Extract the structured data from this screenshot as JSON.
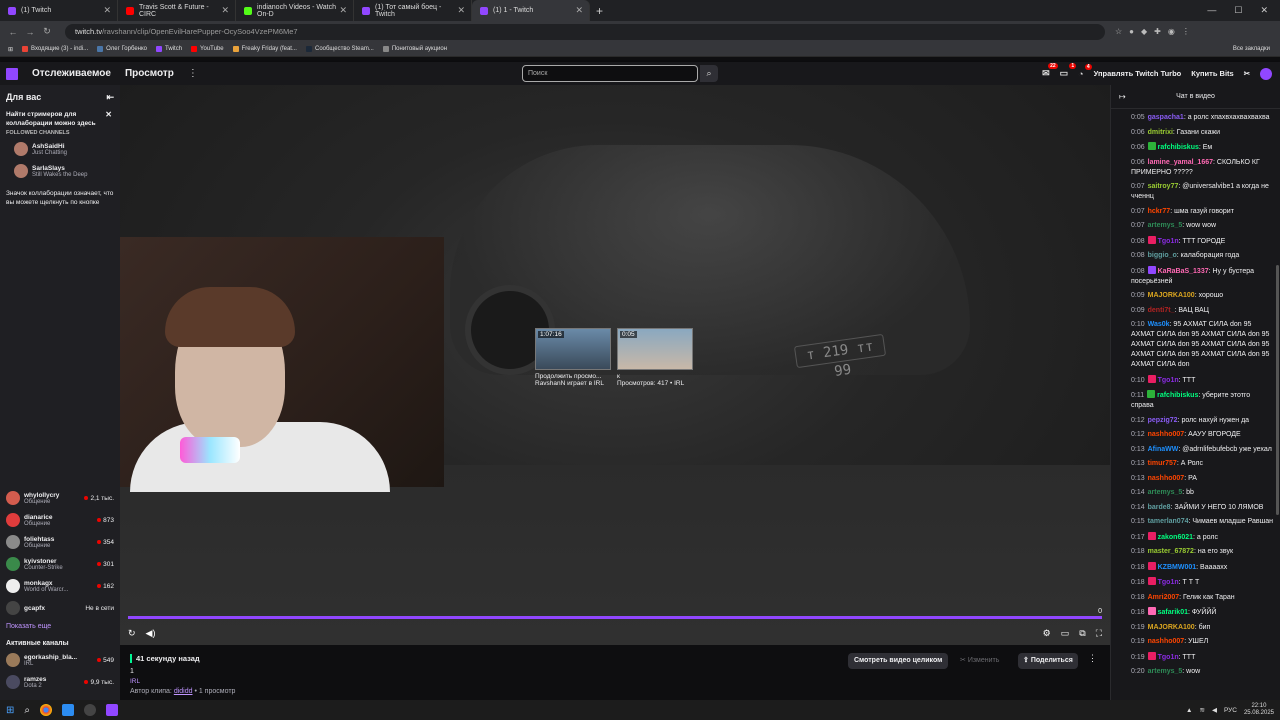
{
  "browser": {
    "tabs": [
      {
        "title": "(1) Twitch",
        "color": "#9147ff",
        "active": false
      },
      {
        "title": "Travis Scott & Future - CIRC",
        "color": "#ff0000",
        "active": false
      },
      {
        "title": "indianoch Videos - Watch On-D",
        "color": "#53fc18",
        "active": false
      },
      {
        "title": "(1) Тот самый боец - Twitch",
        "color": "#9147ff",
        "active": false
      },
      {
        "title": "(1) 1 - Twitch",
        "color": "#9147ff",
        "active": true
      }
    ],
    "url_host": "twitch.tv",
    "url_path": "/ravshann/clip/OpenEvilHarePupper-OcySoo4VzePM6Me7",
    "bookmarks": [
      {
        "label": "Входящие (3) - indi...",
        "color": "#ea4335"
      },
      {
        "label": "Олег Горбенко",
        "color": "#4a76a8"
      },
      {
        "label": "Twitch",
        "color": "#9147ff"
      },
      {
        "label": "YouTube",
        "color": "#ff0000"
      },
      {
        "label": "Freaky Friday (feat...",
        "color": "#e9a23b"
      },
      {
        "label": "Сообщество Steam...",
        "color": "#1b2838"
      },
      {
        "label": "Понитовый аукцион",
        "color": "#888888"
      }
    ],
    "all_bookmarks": "Все закладки"
  },
  "twitch_nav": {
    "following": "Отслеживаемое",
    "browse": "Просмотр",
    "search_placeholder": "Поиск",
    "notif1": "22",
    "notif2": "1",
    "notif3": "4",
    "turbo": "Управлять Twitch Turbo",
    "bits": "Купить Bits"
  },
  "sidebar": {
    "title": "Для вас",
    "popup_title": "Найти стримеров для коллаборации можно здесь",
    "followed_label": "FOLLOWED CHANNELS",
    "popup_channels": [
      {
        "name": "AshSaidHi",
        "sub": "Just Chatting"
      },
      {
        "name": "SarlaSlays",
        "sub": "Still Wakes the Deep"
      }
    ],
    "popup_text": "Значок коллаборации означает, что вы можете щелкнуть по кнопке",
    "channels": [
      {
        "name": "whylollycry",
        "game": "Общение",
        "viewers": "2,1 тыс."
      },
      {
        "name": "dianarice",
        "game": "Общение",
        "viewers": "873"
      },
      {
        "name": "foliehtass",
        "game": "Общение",
        "viewers": "354"
      },
      {
        "name": "kyivstoner",
        "game": "Counter-Strike",
        "viewers": "301"
      },
      {
        "name": "monkagx",
        "game": "World of Warcr...",
        "viewers": "162"
      },
      {
        "name": "gcapfx",
        "game": "",
        "viewers": "Не в сети"
      }
    ],
    "show_more": "Показать еще",
    "active_title": "Активные каналы",
    "active_channels": [
      {
        "name": "egorkaship_bla...",
        "game": "IRL",
        "viewers": "549"
      },
      {
        "name": "ramzes",
        "game": "Dota 2",
        "viewers": "9,9 тыс."
      }
    ]
  },
  "video": {
    "plate": "т 219 тт 99",
    "endcards": [
      {
        "duration": "1:07:16",
        "line1": "Продолжить просмо...",
        "line2": "RavshanN играет в IRL"
      },
      {
        "duration": "0:05",
        "line1": "к",
        "line2": "Просмотров: 417 • IRL"
      }
    ],
    "time": "0"
  },
  "clip_info": {
    "ago": "41 секунду назад",
    "num": "1",
    "category": "IRL",
    "author_prefix": "Автор клипа:",
    "author": "dididd",
    "views": "• 1 просмотр",
    "watch_full": "Смотреть видео целиком",
    "edit": "Изменить",
    "share": "Поделиться"
  },
  "chat": {
    "title": "Чат в видео",
    "messages": [
      {
        "ts": "0:05",
        "user": "gaspacha1",
        "color": "#8a5cf5",
        "text": ": а ролс хпахвхахвахвахва",
        "badge": ""
      },
      {
        "ts": "0:06",
        "user": "dmitrixi",
        "color": "#9acd32",
        "text": ": Газани скажи",
        "badge": ""
      },
      {
        "ts": "0:06",
        "user": "rafchibiskus",
        "color": "#00ff7f",
        "text": ": Ем",
        "badge": "#2db33a"
      },
      {
        "ts": "0:06",
        "user": "lamine_yamal_1667",
        "color": "#ff69b4",
        "text": ": СКОЛЬКО КГ ПРИМЕРНО ?????",
        "badge": ""
      },
      {
        "ts": "0:07",
        "user": "saitroy77",
        "color": "#9acd32",
        "text": ": @universalvibe1 а когда не чченнц",
        "badge": ""
      },
      {
        "ts": "0:07",
        "user": "hckr77",
        "color": "#ff4500",
        "text": ": шма газуй говорит",
        "badge": ""
      },
      {
        "ts": "0:07",
        "user": "artemys_5",
        "color": "#2e8b57",
        "text": ": wow wow",
        "badge": ""
      },
      {
        "ts": "0:08",
        "user": "Tgo1n",
        "color": "#8a2be2",
        "text": ": ТТТ ГОРОДЕ",
        "badge": "#e91e63"
      },
      {
        "ts": "0:08",
        "user": "biggio_o",
        "color": "#5f9ea0",
        "text": ": калаборация года",
        "badge": ""
      },
      {
        "ts": "0:08",
        "user": "KaRaBaS_1337",
        "color": "#ff69b4",
        "text": ": Ну у бустера посерьёзней",
        "badge": "#9147ff"
      },
      {
        "ts": "0:09",
        "user": "MAJORKA100",
        "color": "#daa520",
        "text": ": хорошо",
        "badge": ""
      },
      {
        "ts": "0:09",
        "user": "denti7t_",
        "color": "#b22222",
        "text": ": ВАЦ ВАЦ",
        "badge": ""
      },
      {
        "ts": "0:10",
        "user": "Was0k",
        "color": "#1e90ff",
        "text": ": 95 АХМАТ СИЛА don 95 АХМАТ СИЛА don 95 АХМАТ СИЛА don 95 АХМАТ СИЛА don 95 АХМАТ СИЛА don 95 АХМАТ СИЛА don 95 АХМАТ СИЛА don 95 АХМАТ СИЛА don",
        "badge": ""
      },
      {
        "ts": "0:10",
        "user": "Tgo1n",
        "color": "#8a2be2",
        "text": ": ТТТ",
        "badge": "#e91e63"
      },
      {
        "ts": "0:11",
        "user": "rafchibiskus",
        "color": "#00ff7f",
        "text": ": уберите этотго справа",
        "badge": "#2db33a"
      },
      {
        "ts": "0:12",
        "user": "pepzig72",
        "color": "#8a5cf5",
        "text": ": ролс нахуй нужен да",
        "badge": ""
      },
      {
        "ts": "0:12",
        "user": "nashho007",
        "color": "#ff4500",
        "text": ": ААУУ ВГОРОДЕ",
        "badge": ""
      },
      {
        "ts": "0:13",
        "user": "AfinaWW",
        "color": "#1e90ff",
        "text": ": @adrnlifebufebcb уже уехал",
        "badge": ""
      },
      {
        "ts": "0:13",
        "user": "timur757",
        "color": "#ff4500",
        "text": ": А Ролс",
        "badge": ""
      },
      {
        "ts": "0:13",
        "user": "nashho007",
        "color": "#ff4500",
        "text": ": РА",
        "badge": ""
      },
      {
        "ts": "0:14",
        "user": "artemys_5",
        "color": "#2e8b57",
        "text": ": bb",
        "badge": ""
      },
      {
        "ts": "0:14",
        "user": "barde8",
        "color": "#5f9ea0",
        "text": ": ЗАЙМИ У НЕГО 10 ЛЯМОВ",
        "badge": ""
      },
      {
        "ts": "0:15",
        "user": "tamerlan074",
        "color": "#5f9ea0",
        "text": ": Чимаев младше Равшан",
        "badge": ""
      },
      {
        "ts": "0:17",
        "user": "zakon6021",
        "color": "#00ff7f",
        "text": ": а ролс",
        "badge": "#e91e63"
      },
      {
        "ts": "0:18",
        "user": "master_67872",
        "color": "#9acd32",
        "text": ": на его звук",
        "badge": ""
      },
      {
        "ts": "0:18",
        "user": "KZBMW001",
        "color": "#1e90ff",
        "text": ": Вааааxx",
        "badge": "#e91e63"
      },
      {
        "ts": "0:18",
        "user": "Tgo1n",
        "color": "#8a2be2",
        "text": ": Т Т Т",
        "badge": "#e91e63"
      },
      {
        "ts": "0:18",
        "user": "Amri2007",
        "color": "#ff4500",
        "text": ": Гелик как Таран",
        "badge": ""
      },
      {
        "ts": "0:18",
        "user": "safarik01",
        "color": "#00ff7f",
        "text": ": ФУЙЙЙ",
        "badge": "#ff69b4"
      },
      {
        "ts": "0:19",
        "user": "MAJORKA100",
        "color": "#daa520",
        "text": ": бип",
        "badge": ""
      },
      {
        "ts": "0:19",
        "user": "nashho007",
        "color": "#ff4500",
        "text": ": УШЕЛ",
        "badge": ""
      },
      {
        "ts": "0:19",
        "user": "Tgo1n",
        "color": "#8a2be2",
        "text": ": ТТТ",
        "badge": "#e91e63"
      },
      {
        "ts": "0:20",
        "user": "artemys_5",
        "color": "#2e8b57",
        "text": ": wow",
        "badge": ""
      }
    ]
  },
  "taskbar": {
    "lang": "РУС",
    "time": "22:10",
    "date": "25.08.2025"
  }
}
